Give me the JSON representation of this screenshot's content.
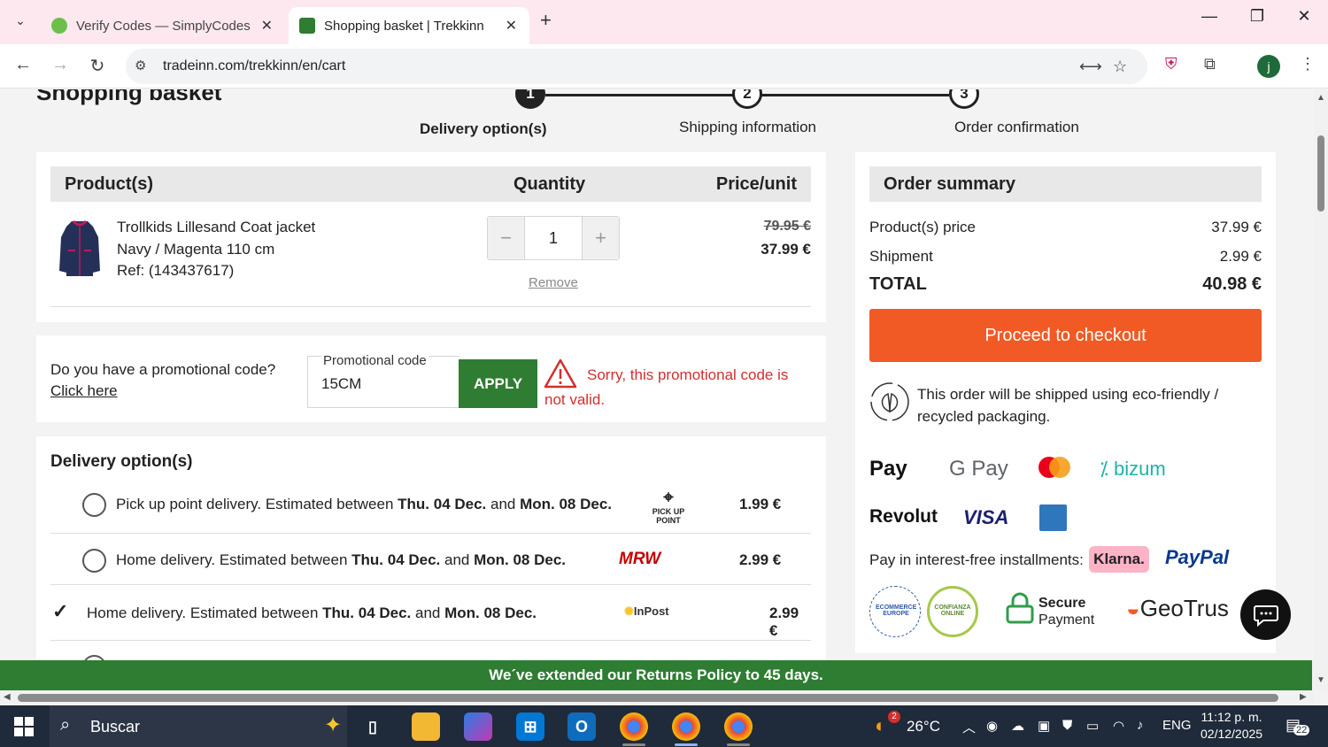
{
  "browser": {
    "tabs": [
      {
        "title": "Verify Codes — SimplyCodes",
        "active": false
      },
      {
        "title": "Shopping basket | Trekkinn",
        "active": true
      }
    ],
    "url": "tradeinn.com/trekkinn/en/cart",
    "profile_initial": "j"
  },
  "page": {
    "title": "Shopping basket",
    "steps": [
      {
        "number": "1",
        "label": "Delivery option(s)"
      },
      {
        "number": "2",
        "label": "Shipping information"
      },
      {
        "number": "3",
        "label": "Order confirmation"
      }
    ]
  },
  "products": {
    "headers": {
      "product": "Product(s)",
      "quantity": "Quantity",
      "price": "Price/unit"
    },
    "items": [
      {
        "name": "Trollkids Lillesand Coat jacket",
        "variant": "Navy / Magenta 110 cm",
        "ref": "Ref: (143437617)",
        "quantity": "1",
        "minus": "−",
        "plus": "+",
        "remove": "Remove",
        "old_price": "79.95 €",
        "price": "37.99 €"
      }
    ]
  },
  "promo": {
    "question": "Do you have a promotional code?",
    "link": "Click here",
    "label": "Promotional code",
    "value": "15CM",
    "apply": "APPLY",
    "error_line1": "Sorry, this promotional code is",
    "error_line2": "not valid."
  },
  "delivery": {
    "title": "Delivery option(s)",
    "options": [
      {
        "pre": "Pick up point delivery. Estimated between ",
        "d1": "Thu. 04 Dec.",
        "mid": " and ",
        "d2": "Mon. 08 Dec.",
        "carrier": "PICK UP POINT",
        "price": "1.99 €",
        "selected": false
      },
      {
        "pre": "Home delivery. Estimated between ",
        "d1": "Thu. 04 Dec.",
        "mid": " and ",
        "d2": "Mon. 08 Dec.",
        "carrier": "MRW",
        "price": "2.99 €",
        "selected": false
      },
      {
        "pre": "Home delivery. Estimated between ",
        "d1": "Thu. 04 Dec.",
        "mid": " and ",
        "d2": "Mon. 08 Dec.",
        "carrier": "InPost",
        "price": "2.99 €",
        "selected": true
      }
    ]
  },
  "summary": {
    "title": "Order summary",
    "rows": [
      {
        "label": "Product(s) price",
        "value": "37.99 €"
      },
      {
        "label": "Shipment",
        "value": "2.99 €"
      }
    ],
    "total_label": "TOTAL",
    "total_value": "40.98 €",
    "checkout": "Proceed to checkout",
    "eco": "This order will be shipped using eco-friendly / recycled packaging.",
    "payment_logos": [
      "Pay",
      "G Pay",
      "bizum",
      "Revolut",
      "VISA"
    ],
    "installments": "Pay in interest-free installments:",
    "klarna": "Klarna.",
    "paypal": "PayPal",
    "secure": [
      "Secure",
      "Payment"
    ],
    "geotrust": "GeoTrus",
    "trust_badges": [
      "ECOMMERCE EUROPE",
      "CONFIANZA ONLINE"
    ]
  },
  "banner": "We´ve extended our Returns Policy to 45 days.",
  "taskbar": {
    "search_placeholder": "Buscar",
    "weather": "26°C",
    "weather_badge": "2",
    "language": "ENG",
    "time": "11:12 p. m.",
    "date": "02/12/2025",
    "notifications": "22"
  },
  "colors": {
    "tabbar": "#fde8ef",
    "apply_green": "#2e7d32",
    "checkout_orange": "#f15a24",
    "error_red": "#d32f2f",
    "banner_green": "#2e7d32",
    "taskbar": "#1f2a3a"
  }
}
